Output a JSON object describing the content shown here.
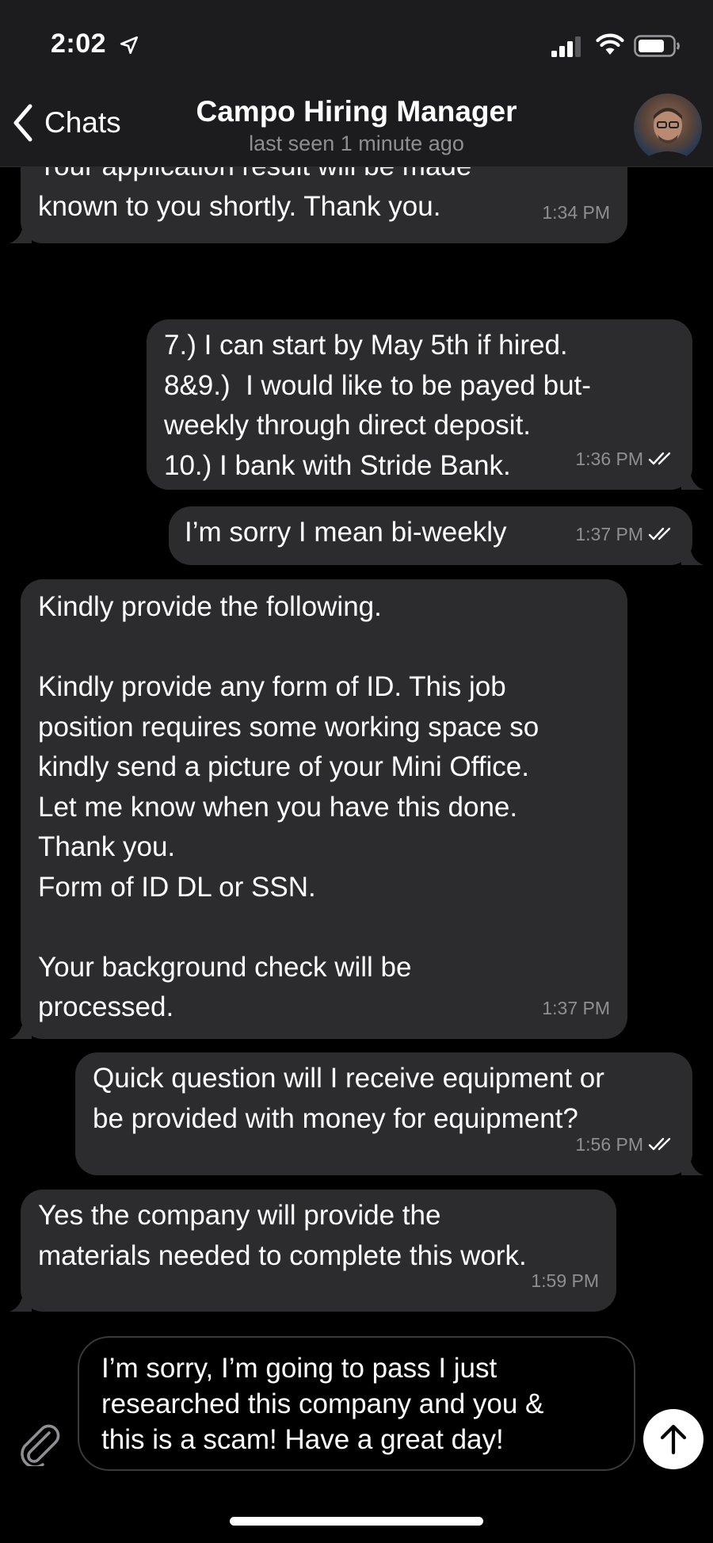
{
  "status_bar": {
    "time": "2:02"
  },
  "header": {
    "back_label": "Chats",
    "title": "Campo Hiring Manager",
    "subtitle": "last seen 1 minute ago"
  },
  "messages": [
    {
      "direction": "in",
      "text": "Your application result will be made\nknown to you shortly. Thank you.",
      "time": "1:34 PM"
    },
    {
      "direction": "out",
      "text": "7.) I can start by May 5th if hired.\n8&9.)  I would like to be payed but-\nweekly through direct deposit.\n10.) I bank with Stride Bank.",
      "time": "1:36 PM",
      "read": true
    },
    {
      "direction": "out",
      "text": "I’m sorry I mean bi-weekly",
      "time": "1:37 PM",
      "read": true
    },
    {
      "direction": "in",
      "text": "Kindly provide the following.\n\nKindly provide any form of ID. This job\nposition requires some working space so\nkindly send a picture of your Mini Office.\nLet me know when you have this done.\nThank you.\nForm of ID DL or SSN.\n\nYour background check will be\nprocessed.",
      "time": "1:37 PM"
    },
    {
      "direction": "out",
      "text": "Quick question will I receive equipment or\nbe provided with money for equipment?",
      "time": "1:56 PM",
      "read": true
    },
    {
      "direction": "in",
      "text": "Yes the company will provide the\nmaterials needed to complete this work.",
      "time": "1:59 PM"
    }
  ],
  "composer": {
    "draft": "I’m sorry, I’m going to pass I just\nresearched this company and you &\nthis is a scam! Have a great day!"
  },
  "icons": {
    "back": "chevron-left-icon",
    "attach": "paperclip-icon",
    "send": "arrow-up-icon",
    "read_receipt": "double-check-icon"
  },
  "colors": {
    "bubble": "#2c2c2e",
    "background": "#000000",
    "meta": "#8e8e93"
  }
}
